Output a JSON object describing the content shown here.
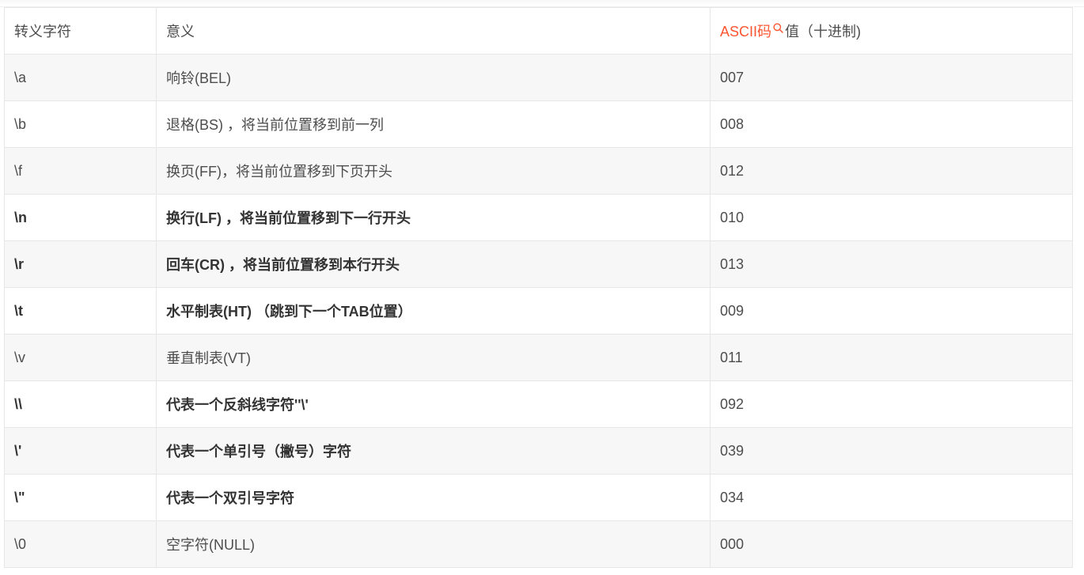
{
  "header": {
    "col_escape": "转义字符",
    "col_meaning": "意义",
    "col_ascii_link": "ASCII码",
    "col_ascii_rest": "值（十进制)"
  },
  "rows": [
    {
      "esc": "\\a",
      "meaning": "响铃(BEL)",
      "code": "007",
      "bold": false
    },
    {
      "esc": "\\b",
      "meaning": "退格(BS) ，将当前位置移到前一列",
      "code": "008",
      "bold": false
    },
    {
      "esc": "\\f",
      "meaning": "换页(FF)，将当前位置移到下页开头",
      "code": "012",
      "bold": false
    },
    {
      "esc": "\\n",
      "meaning": "换行(LF) ，将当前位置移到下一行开头",
      "code": "010",
      "bold": true
    },
    {
      "esc": "\\r",
      "meaning": "回车(CR) ，将当前位置移到本行开头",
      "code": "013",
      "bold": true
    },
    {
      "esc": "\\t",
      "meaning": "水平制表(HT) （跳到下一个TAB位置）",
      "code": "009",
      "bold": true
    },
    {
      "esc": "\\v",
      "meaning": "垂直制表(VT)",
      "code": "011",
      "bold": false
    },
    {
      "esc": "\\\\",
      "meaning": "代表一个反斜线字符''\\'",
      "code": "092",
      "bold": true
    },
    {
      "esc": "\\'",
      "meaning": "代表一个单引号（撇号）字符",
      "code": "039",
      "bold": true
    },
    {
      "esc": "\\\"",
      "meaning": "代表一个双引号字符",
      "code": "034",
      "bold": true
    },
    {
      "esc": "\\0",
      "meaning": "空字符(NULL)",
      "code": "000",
      "bold": false
    }
  ],
  "colors": {
    "link": "#fc5531",
    "text": "#4d4d4d",
    "stripe": "#f7f7f7",
    "border": "#e6e6e6"
  },
  "icons": {
    "search": "search-icon"
  }
}
